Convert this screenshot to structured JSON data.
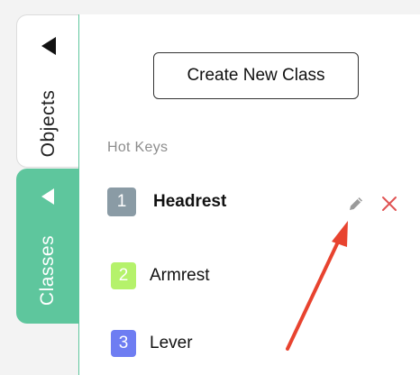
{
  "tabs": {
    "objects_label": "Objects",
    "classes_label": "Classes"
  },
  "panel": {
    "create_button_label": "Create New Class",
    "section_label": "Hot Keys"
  },
  "classes": [
    {
      "hotkey": "1",
      "name": "Headrest",
      "color": "#8a9ba5",
      "selected": true
    },
    {
      "hotkey": "2",
      "name": "Armrest",
      "color": "#b5f26b",
      "selected": false
    },
    {
      "hotkey": "3",
      "name": "Lever",
      "color": "#6e7df2",
      "selected": false
    }
  ],
  "icons": {
    "edit": "pencil-icon",
    "delete": "close-icon"
  },
  "colors": {
    "accent": "#5ec69d",
    "delete": "#e05353",
    "annotation_arrow": "#e8432f"
  }
}
